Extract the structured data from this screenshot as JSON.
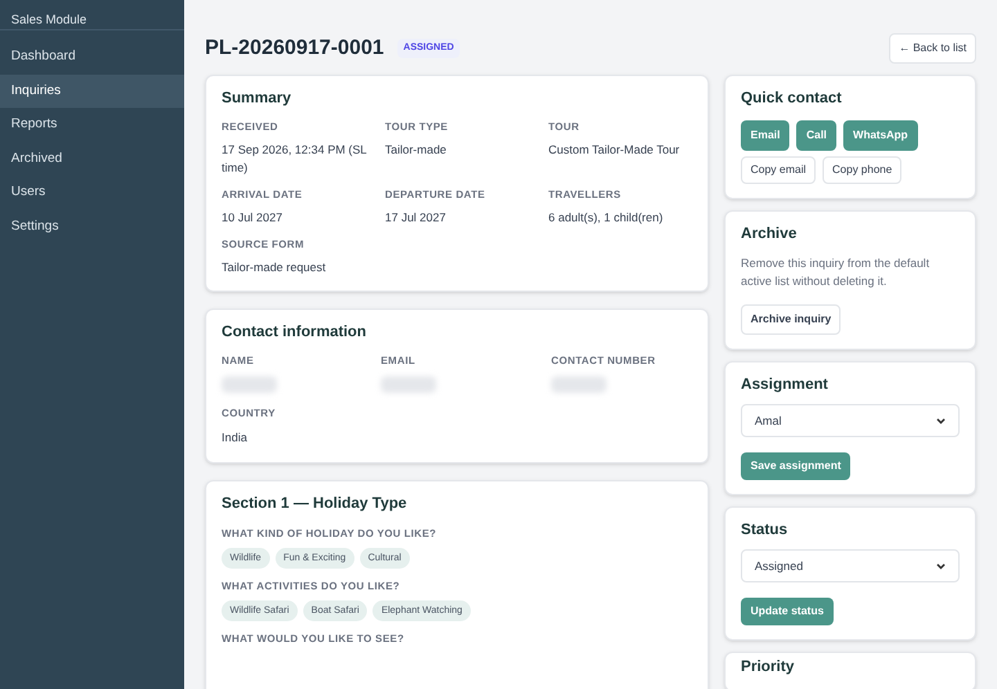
{
  "sidebar": {
    "title": "Sales Module",
    "items": [
      {
        "label": "Dashboard",
        "selected": false
      },
      {
        "label": "Inquiries",
        "selected": true
      },
      {
        "label": "Reports",
        "selected": false
      },
      {
        "label": "Archived",
        "selected": false
      },
      {
        "label": "Users",
        "selected": false
      },
      {
        "label": "Settings",
        "selected": false
      }
    ]
  },
  "header": {
    "reference": "PL-20260917-0001",
    "status_badge": "ASSIGNED",
    "back_button": "← Back to list"
  },
  "summary": {
    "title": "Summary",
    "fields": [
      {
        "label": "RECEIVED",
        "value": "17 Sep 2026, 12:34 PM (SL time)"
      },
      {
        "label": "TOUR TYPE",
        "value": "Tailor-made"
      },
      {
        "label": "TOUR",
        "value": "Custom Tailor-Made Tour"
      },
      {
        "label": "ARRIVAL DATE",
        "value": "10 Jul 2027"
      },
      {
        "label": "DEPARTURE DATE",
        "value": "17 Jul 2027"
      },
      {
        "label": "TRAVELLERS",
        "value": "6 adult(s), 1 child(ren)"
      },
      {
        "label": "SOURCE FORM",
        "value": "Tailor-made request"
      }
    ]
  },
  "contact": {
    "title": "Contact information",
    "fields": [
      {
        "label": "NAME",
        "redacted": true
      },
      {
        "label": "EMAIL",
        "redacted": true
      },
      {
        "label": "CONTACT NUMBER",
        "redacted": true
      },
      {
        "label": "COUNTRY",
        "value": "India",
        "redacted": false
      }
    ]
  },
  "section_1": {
    "title": "Section 1 — Holiday Type",
    "questions": [
      {
        "label": "WHAT KIND OF HOLIDAY DO YOU LIKE?",
        "tags": [
          "Wildlife",
          "Fun & Exciting",
          "Cultural"
        ]
      },
      {
        "label": "WHAT ACTIVITIES DO YOU LIKE?",
        "tags": [
          "Wildlife Safari",
          "Boat Safari",
          "Elephant Watching"
        ]
      },
      {
        "label": "WHAT WOULD YOU LIKE TO SEE?"
      }
    ]
  },
  "quick_contact": {
    "title": "Quick contact",
    "primary_buttons": [
      "Email",
      "Call",
      "WhatsApp"
    ],
    "secondary_buttons": [
      "Copy email",
      "Copy phone"
    ]
  },
  "archive": {
    "title": "Archive",
    "description": "Remove this inquiry from the default active list without deleting it.",
    "button": "Archive inquiry"
  },
  "assignment": {
    "title": "Assignment",
    "value": "Amal",
    "button": "Save assignment"
  },
  "status": {
    "title": "Status",
    "value": "Assigned",
    "button": "Update status"
  },
  "priority": {
    "title": "Priority"
  }
}
